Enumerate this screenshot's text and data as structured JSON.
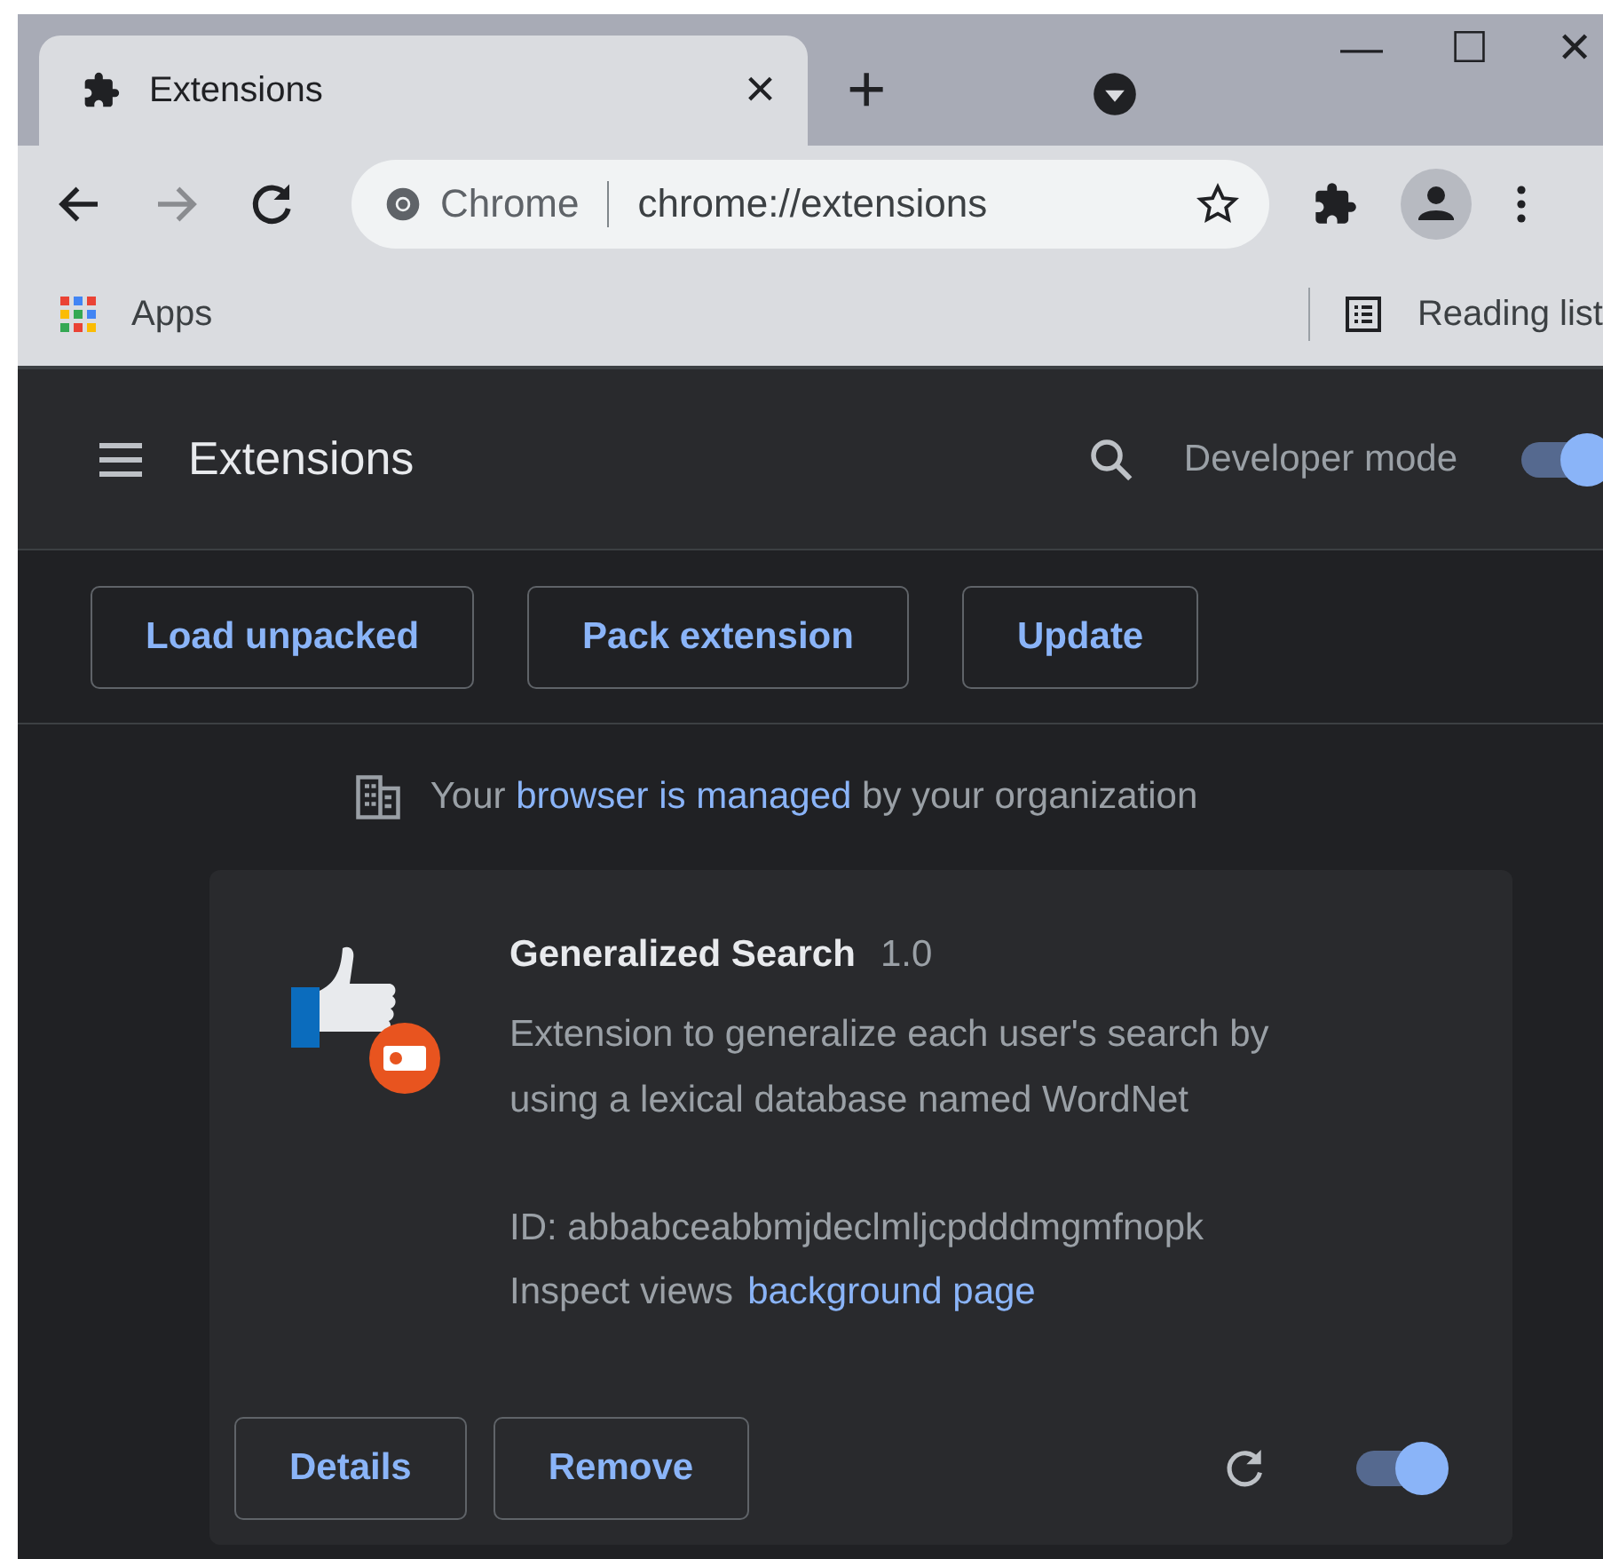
{
  "tab": {
    "title": "Extensions",
    "close": "×",
    "new_tab": "+"
  },
  "window_controls": {
    "minimize": "—",
    "maximize": "☐",
    "close": "✕"
  },
  "omnibox": {
    "site": "Chrome",
    "url": "chrome://extensions"
  },
  "bookmarks": {
    "apps": "Apps",
    "reading_list": "Reading list"
  },
  "header": {
    "title": "Extensions",
    "developer_mode": {
      "label": "Developer mode",
      "on": true
    }
  },
  "actions": [
    "Load unpacked",
    "Pack extension",
    "Update"
  ],
  "managed": {
    "prefix": "Your",
    "link": "browser is managed",
    "suffix": "by your organization"
  },
  "extension": {
    "name": "Generalized Search",
    "version": "1.0",
    "description": "Extension to generalize each user's search by using a lexical database named WordNet",
    "id": "ID: abbabceabbmjdeclmljcpdddmgmfnopk",
    "inspect_label": "Inspect views",
    "inspect_link": "background page",
    "buttons": [
      "Details",
      "Remove"
    ],
    "enabled": true
  }
}
